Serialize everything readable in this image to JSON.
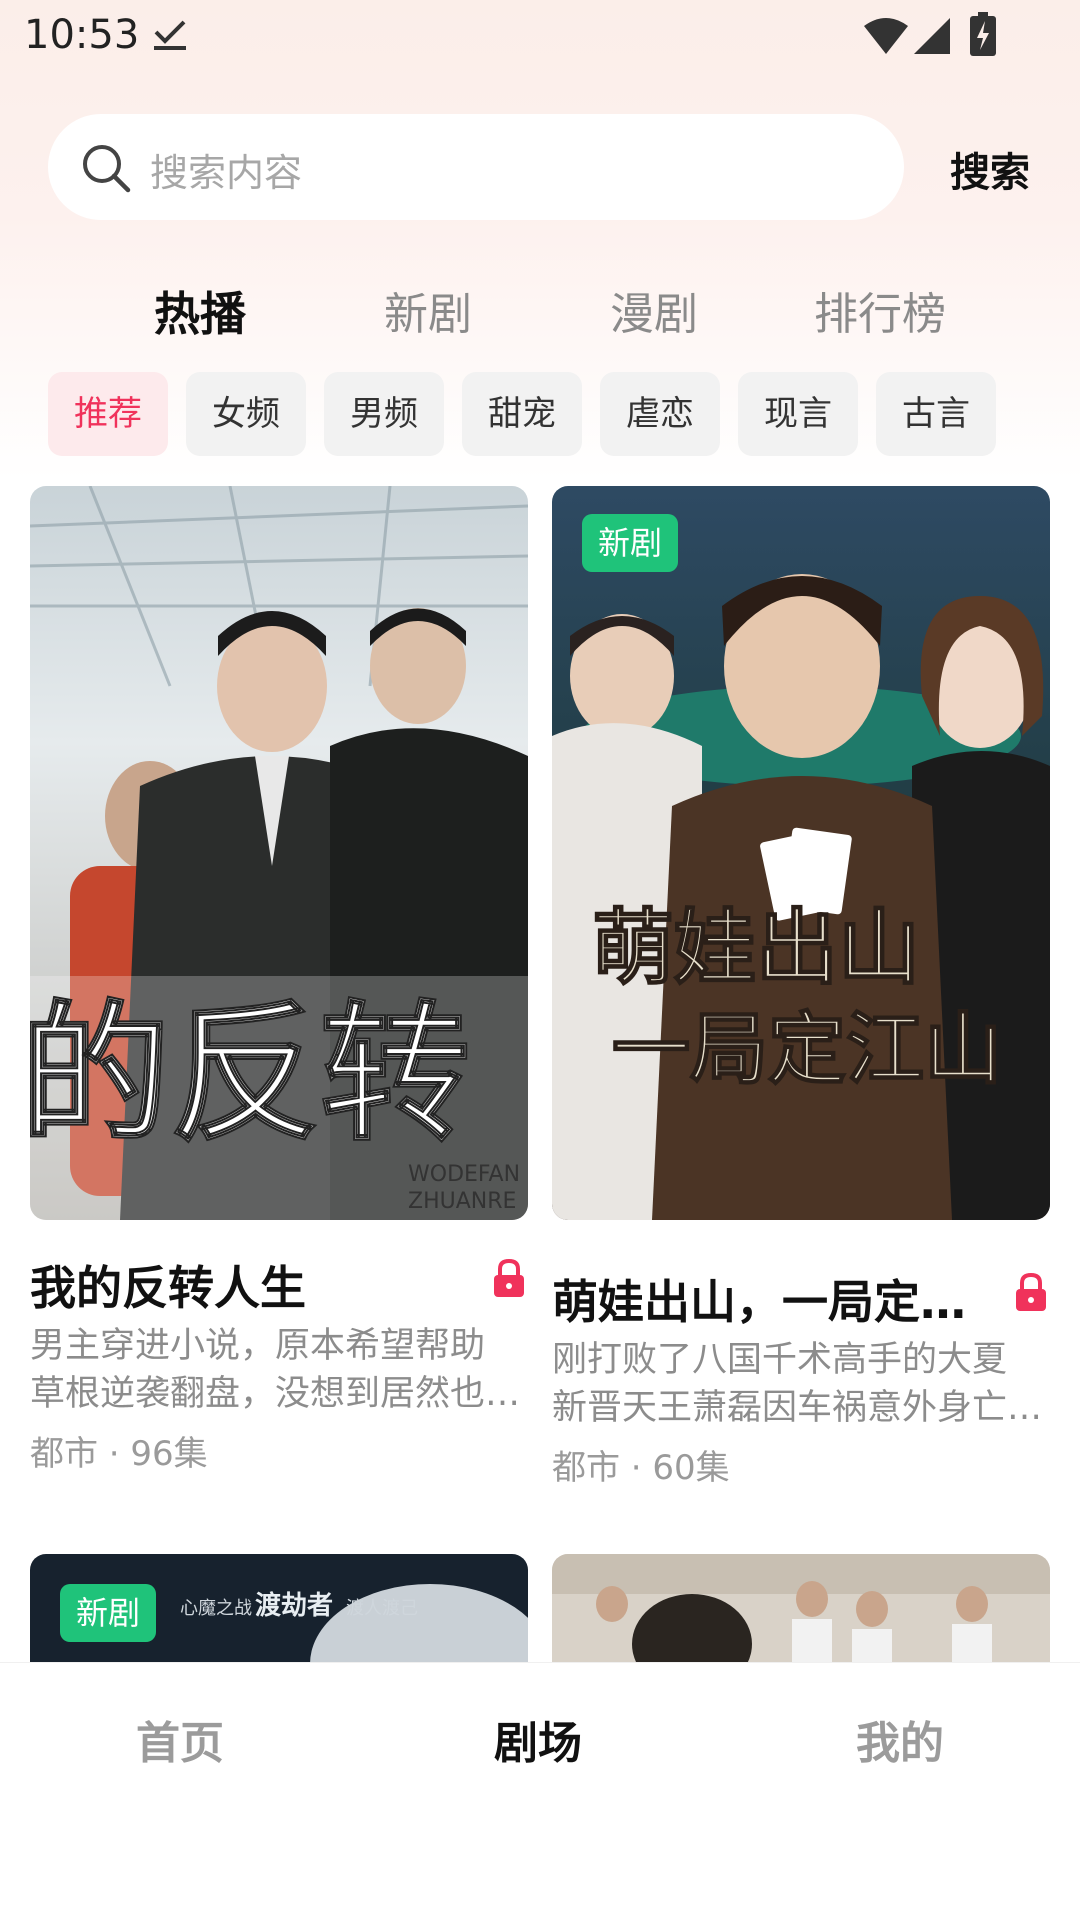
{
  "status_bar": {
    "time": "10:53"
  },
  "search": {
    "placeholder": "搜索内容",
    "button_label": "搜索"
  },
  "tabs": [
    {
      "label": "热播",
      "active": true
    },
    {
      "label": "新剧",
      "active": false
    },
    {
      "label": "漫剧",
      "active": false
    },
    {
      "label": "排行榜",
      "active": false
    }
  ],
  "chips": [
    {
      "label": "推荐",
      "active": true
    },
    {
      "label": "女频",
      "active": false
    },
    {
      "label": "男频",
      "active": false
    },
    {
      "label": "甜宠",
      "active": false
    },
    {
      "label": "虐恋",
      "active": false
    },
    {
      "label": "现言",
      "active": false
    },
    {
      "label": "古言",
      "active": false
    }
  ],
  "cards": [
    {
      "title": "我的反转人生",
      "description_line1": "男主穿进小说，原本希望帮助",
      "description_line2": "草根逆袭翻盘，没想到居然也…",
      "meta": "都市 · 96集",
      "poster_text": "的反转",
      "poster_subtext1": "WODEFAN",
      "poster_subtext2": "ZHUANRE",
      "badge": "",
      "locked": true
    },
    {
      "title": "萌娃出山，一局定…",
      "description_line1": "刚打败了八国千术高手的大夏",
      "description_line2": "新晋天王萧磊因车祸意外身亡…",
      "meta": "都市 · 60集",
      "poster_text_line1": "萌娃出山",
      "poster_text_line2": "一局定江山",
      "badge": "新剧",
      "locked": true
    }
  ],
  "partial_cards": [
    {
      "badge": "新剧",
      "poster_text": "渡劫者",
      "poster_small_text": "心魔之战",
      "poster_small_text2": "渡人渡己"
    },
    {
      "badge": ""
    }
  ],
  "bottom_nav": [
    {
      "label": "首页",
      "active": false
    },
    {
      "label": "剧场",
      "active": true
    },
    {
      "label": "我的",
      "active": false
    }
  ],
  "colors": {
    "accent": "#f0325b",
    "badge_green": "#1fc37a",
    "chip_bg": "#f2f2f2",
    "active_chip_bg": "#fdeaec"
  }
}
